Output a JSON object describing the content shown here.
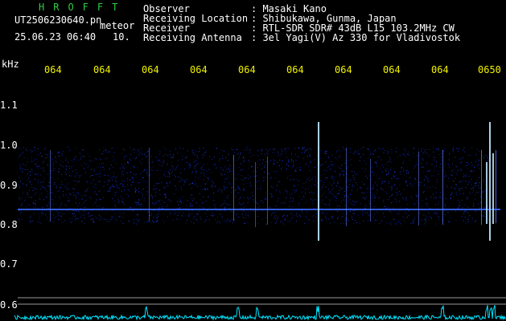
{
  "header": {
    "brand": "HROFFT",
    "filename": "UT2506230640.pn",
    "tag": "meteor",
    "datetime": "25.06.23 06:40",
    "counter": "10.",
    "observer_label": "Observer",
    "observer_value": ": Masaki Kano",
    "location_label": "Receiving Location",
    "location_value": ": Shibukawa, Gunma, Japan",
    "receiver_label": "Receiver",
    "receiver_value": ": RTL-SDR SDR# 43dB L15 103.2MHz CW",
    "antenna_label": "Receiving Antenna",
    "antenna_value": ": 3el Yagi(V) Az 330 for Vladivostok"
  },
  "axis": {
    "unit": "kHz",
    "y_ticks": [
      "1.1",
      "1.0",
      "0.9",
      "0.8",
      "0.7",
      "0.6"
    ],
    "x_ticks": [
      "064",
      "064",
      "064",
      "064",
      "064",
      "064",
      "064",
      "064",
      "064",
      "0650"
    ]
  },
  "colors": {
    "background": "#000000",
    "text": "#ffffff",
    "brand": "#2ecc40",
    "time_ticks": "#f2f200",
    "noise": "#1a3cff",
    "meteor": "#bfe8ff",
    "amplitude": "#00e5ff"
  }
}
